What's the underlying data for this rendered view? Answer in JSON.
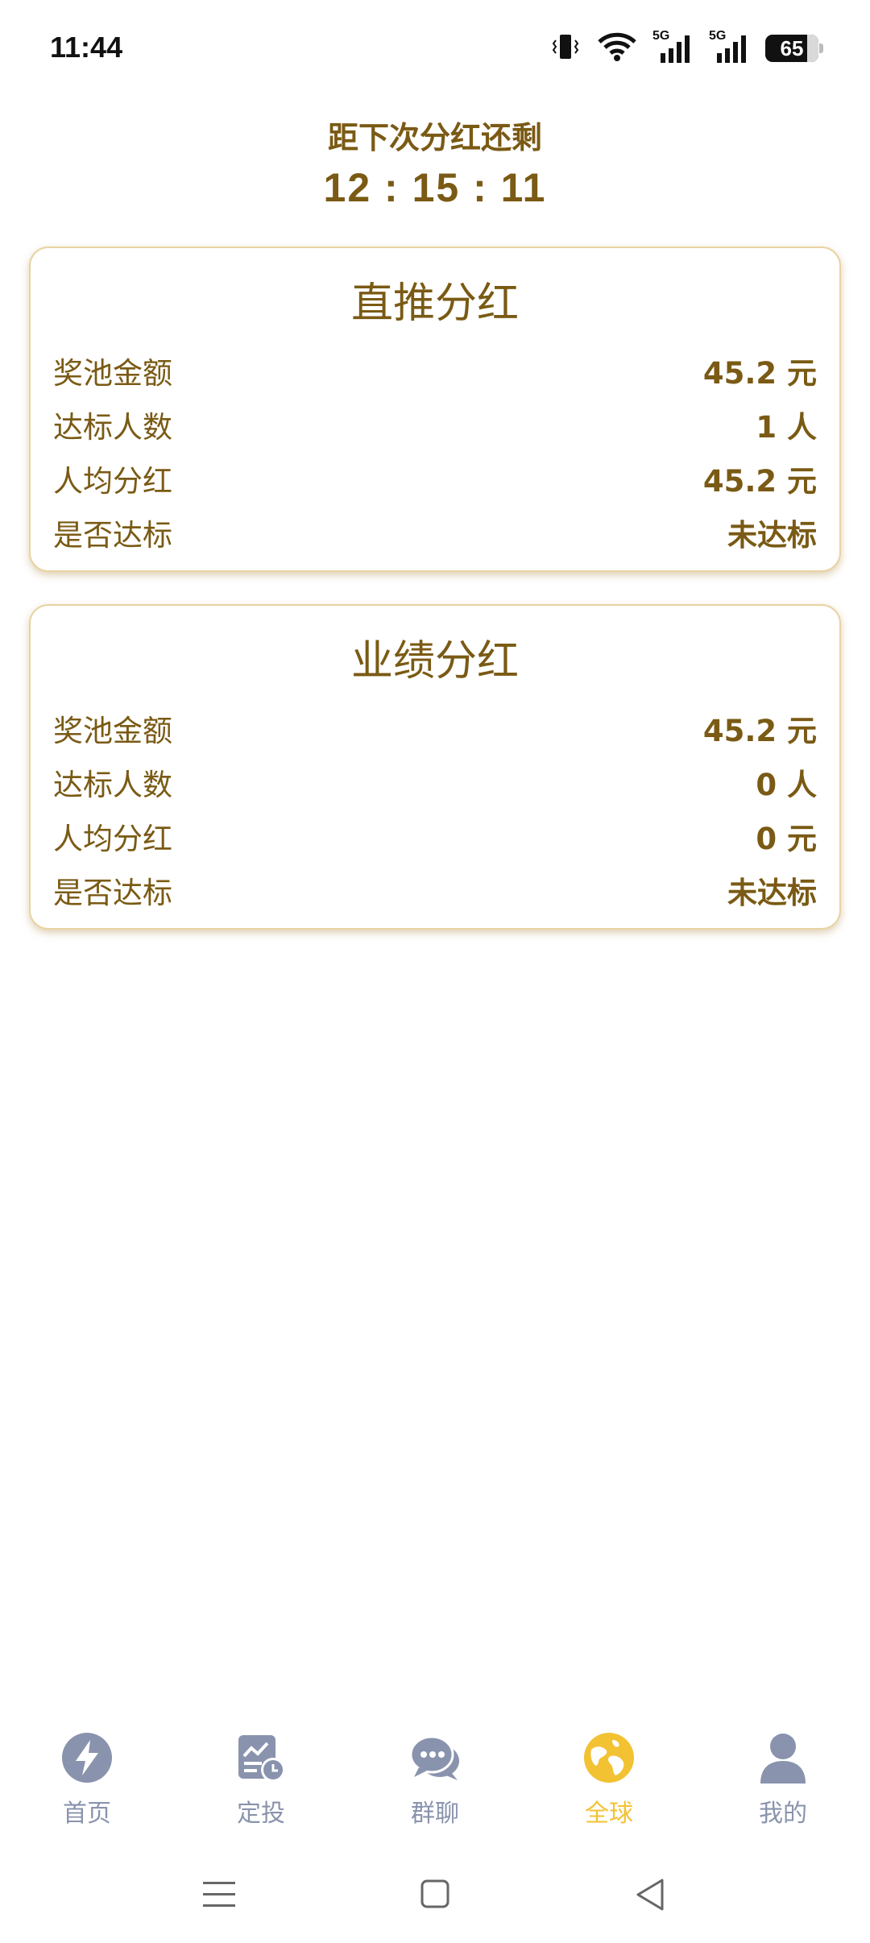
{
  "status_bar": {
    "time": "11:44",
    "battery": "65",
    "icons": [
      "vibrate-icon",
      "wifi-icon",
      "signal-5g-icon",
      "signal-5g-icon",
      "battery-icon"
    ],
    "network_label": "5G"
  },
  "countdown": {
    "title": "距下次分红还剩",
    "time": "12 : 15 : 11"
  },
  "cards": [
    {
      "title": "直推分红",
      "rows": [
        {
          "label": "奖池金额",
          "value": "45.2 元"
        },
        {
          "label": "达标人数",
          "value": "1 人"
        },
        {
          "label": "人均分红",
          "value": "45.2 元"
        },
        {
          "label": "是否达标",
          "value": "未达标"
        }
      ]
    },
    {
      "title": "业绩分红",
      "rows": [
        {
          "label": "奖池金额",
          "value": "45.2 元"
        },
        {
          "label": "达标人数",
          "value": "0 人"
        },
        {
          "label": "人均分红",
          "value": "0 元"
        },
        {
          "label": "是否达标",
          "value": "未达标"
        }
      ]
    }
  ],
  "bottom_nav": {
    "items": [
      {
        "label": "首页",
        "icon": "lightning-icon",
        "active": false
      },
      {
        "label": "定投",
        "icon": "chart-clock-icon",
        "active": false
      },
      {
        "label": "群聊",
        "icon": "chat-bubbles-icon",
        "active": false
      },
      {
        "label": "全球",
        "icon": "globe-icon",
        "active": true
      },
      {
        "label": "我的",
        "icon": "user-icon",
        "active": false
      }
    ]
  },
  "system_nav": {
    "buttons": [
      "menu-icon",
      "home-icon",
      "back-icon"
    ]
  },
  "colors": {
    "accent_brown": "#7a5a14",
    "active_gold": "#f2c233",
    "inactive_gray": "#8a93ad",
    "card_border": "#e9d3a3"
  }
}
